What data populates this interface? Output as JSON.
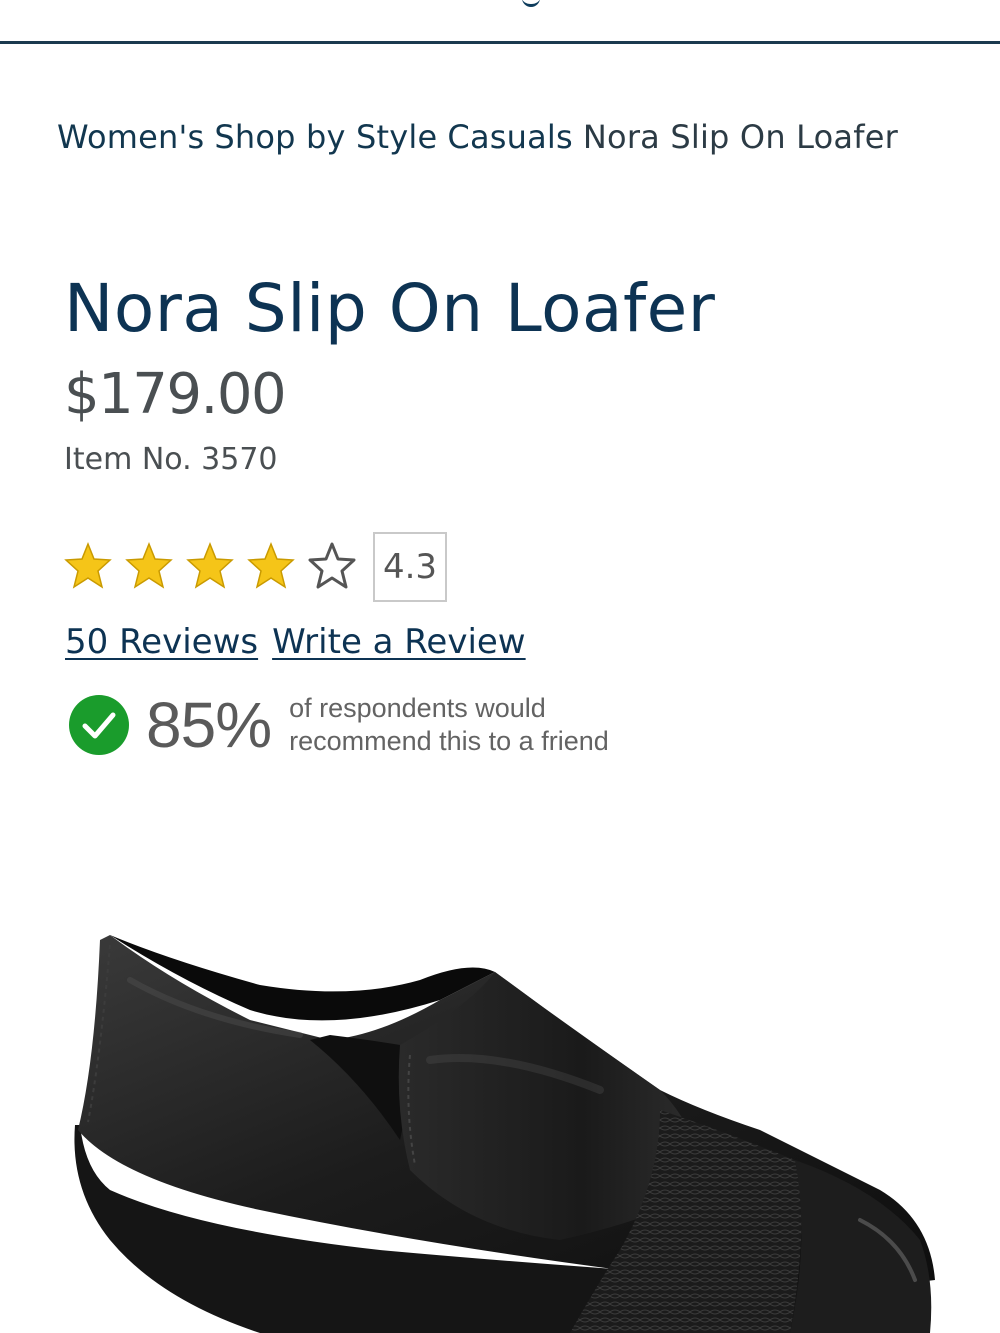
{
  "breadcrumb": {
    "items": [
      {
        "label": "Women's"
      },
      {
        "label": "Shop by Style"
      },
      {
        "label": "Casuals"
      },
      {
        "label": "Nora Slip On Loafer"
      }
    ]
  },
  "product": {
    "title": "Nora Slip On Loafer",
    "price": "$179.00",
    "item_no": "Item No. 3570",
    "image_icon": "shoe-image"
  },
  "rating": {
    "value": "4.3",
    "stars_filled": 4,
    "stars_total": 5,
    "star_color": "#f5c518",
    "star_outline": "#555555"
  },
  "reviews": {
    "count_link": "50 Reviews",
    "write_link": "Write a Review"
  },
  "recommend": {
    "percent": "85%",
    "line1": "of respondents would",
    "line2": "recommend this to a friend",
    "icon": "check-circle-icon",
    "icon_color": "#1a9c2c"
  },
  "colors": {
    "brand": "#0d3353",
    "text_gray": "#4a4f52"
  }
}
